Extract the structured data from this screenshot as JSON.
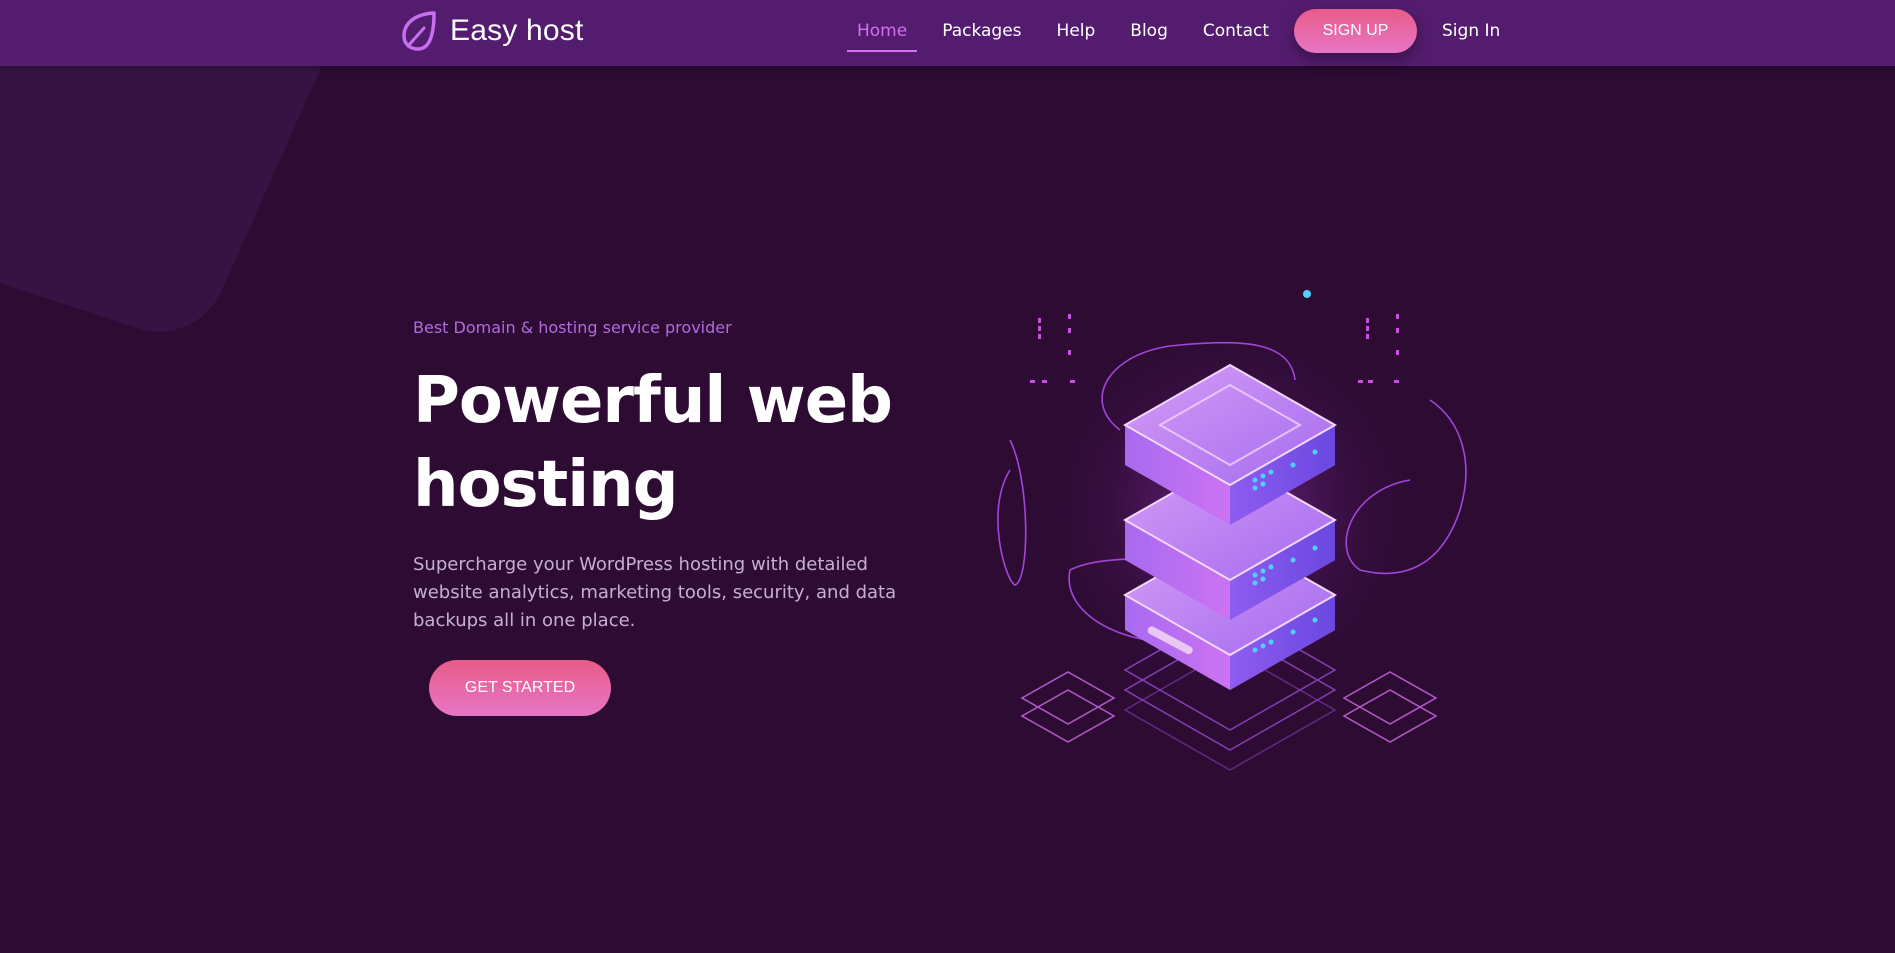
{
  "brand": {
    "name": "Easy host",
    "icon": "leaf-icon"
  },
  "nav": {
    "items": [
      {
        "label": "Home",
        "active": true
      },
      {
        "label": "Packages",
        "active": false
      },
      {
        "label": "Help",
        "active": false
      },
      {
        "label": "Blog",
        "active": false
      },
      {
        "label": "Contact",
        "active": false
      }
    ],
    "signup_label": "SIGN UP",
    "signin_label": "Sign In"
  },
  "hero": {
    "tagline": "Best Domain & hosting service provider",
    "title_line1": "Powerful web",
    "title_line2": "hosting",
    "description": "Supercharge your WordPress hosting with detailed website analytics, marketing tools, security, and data backups all in one place.",
    "cta_label": "GET STARTED"
  },
  "illustration": {
    "icon": "server-stack-illustration"
  },
  "colors": {
    "background": "#2d0b33",
    "navbar": "#541c6e",
    "accent": "#d56ff0",
    "button_top": "#e95b87",
    "button_bottom": "#e676c6"
  }
}
